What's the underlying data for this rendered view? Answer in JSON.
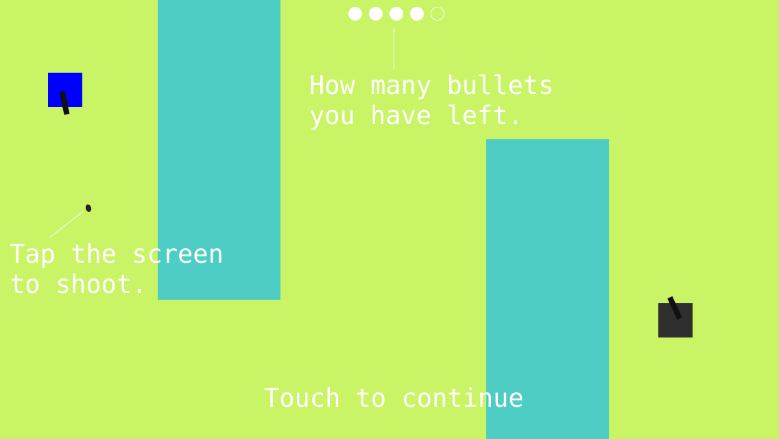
{
  "ammo": {
    "total": 5,
    "remaining": 4
  },
  "hints": {
    "ammo_line1": "How many bullets",
    "ammo_line2": "you have left.",
    "shoot_line1": "Tap the screen",
    "shoot_line2": "to shoot."
  },
  "continue_prompt": "Touch to continue",
  "colors": {
    "background": "#c8f465",
    "wall": "#4ecdc4",
    "player_tank": "#0000ff",
    "enemy_tank": "#2f2f2f"
  }
}
